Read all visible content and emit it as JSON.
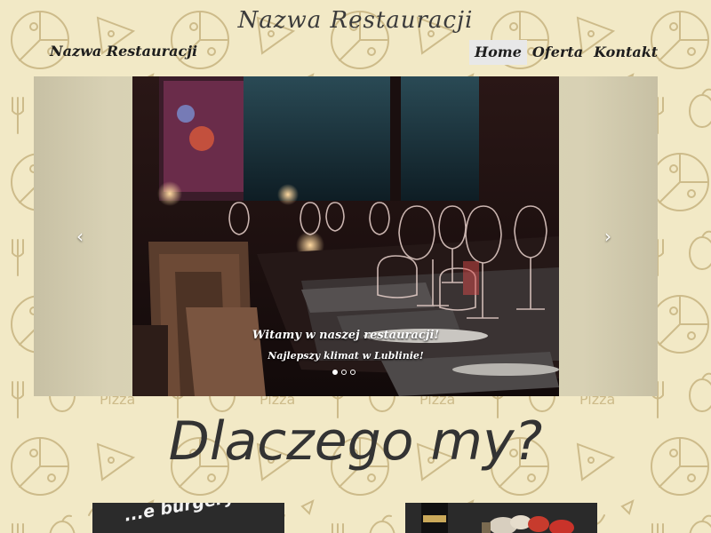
{
  "site": {
    "brand_top": "Nazwa Restauracji",
    "brand_nav": "Nazwa Restauracji"
  },
  "nav": {
    "items": [
      {
        "label": "Home",
        "active": true
      },
      {
        "label": "Oferta",
        "active": false
      },
      {
        "label": "Kontakt",
        "active": false
      }
    ]
  },
  "carousel": {
    "caption_title": "Witamy w naszej restauracji!",
    "caption_subtitle": "Najlepszy klimat w Lublinie!",
    "active_slide": 0,
    "slide_count": 3,
    "prev_icon": "chevron-left-icon",
    "next_icon": "chevron-right-icon"
  },
  "section": {
    "title": "Dlaczego my?"
  },
  "cards": [
    {
      "text": "...e burgery."
    },
    {
      "text": ""
    }
  ],
  "colors": {
    "background": "#f2e9c6",
    "doodle_stroke": "#cdbb8a",
    "text_dark": "#333333",
    "nav_active_bg": "#e8e8e8"
  }
}
